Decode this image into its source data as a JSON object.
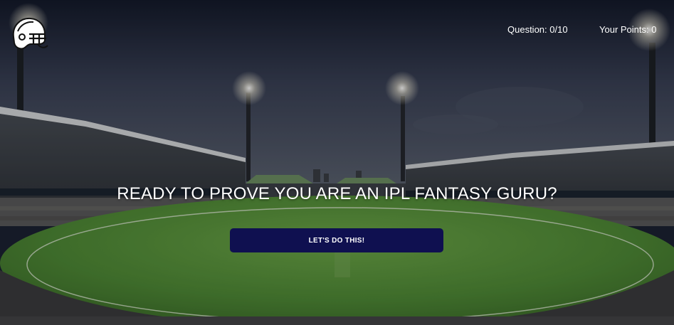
{
  "header": {
    "logo_icon": "football-helmet-icon",
    "question_label": "Question: 0/10",
    "points_label": "Your Points: 0"
  },
  "main": {
    "headline": "READY TO PROVE YOU ARE AN IPL FANTASY GURU?",
    "cta_label": "LET'S DO THIS!"
  },
  "colors": {
    "cta_background": "#0f1050",
    "text": "#ffffff",
    "pitch_green": "#4f8a36"
  }
}
